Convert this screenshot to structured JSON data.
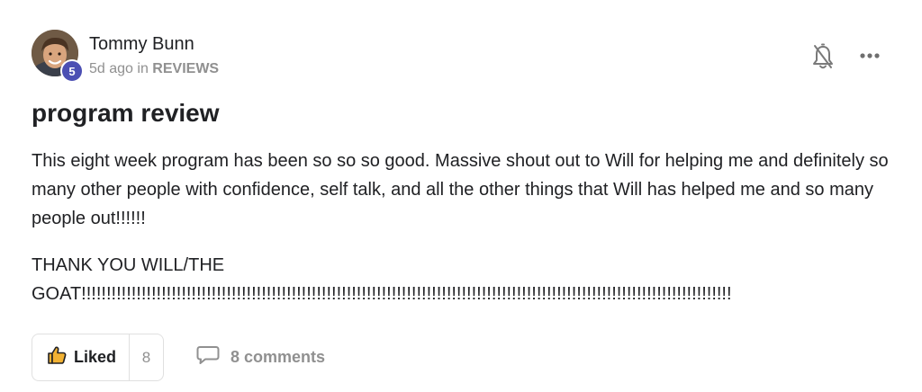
{
  "author": {
    "name": "Tommy Bunn",
    "level": "5",
    "avatar_icon": "user-avatar-photo"
  },
  "meta": {
    "time": "5d ago",
    "in_text": "in",
    "category": "REVIEWS"
  },
  "post": {
    "title": "program review",
    "body_paragraph_1": "This eight week program has been so so so good. Massive shout out to Will for helping me and definitely so many other people with confidence, self talk, and all the other things that Will has helped me and so many people out!!!!!!",
    "body_line_2a": "THANK YOU WILL/THE",
    "body_line_2b": "GOAT!!!!!!!!!!!!!!!!!!!!!!!!!!!!!!!!!!!!!!!!!!!!!!!!!!!!!!!!!!!!!!!!!!!!!!!!!!!!!!!!!!!!!!!!!!!!!!!!!!!!!!!!!!!!!!!!!!!!!!!!!!!!!!!!!!"
  },
  "actions": {
    "like_label": "Liked",
    "like_count": "8",
    "comments_label": "8 comments",
    "bell_icon": "bell-off-icon",
    "more_icon": "more-dots-icon"
  },
  "colors": {
    "badge": "#4b4fb3",
    "muted": "#909090",
    "text": "#202124",
    "border": "#e0e0e0"
  }
}
